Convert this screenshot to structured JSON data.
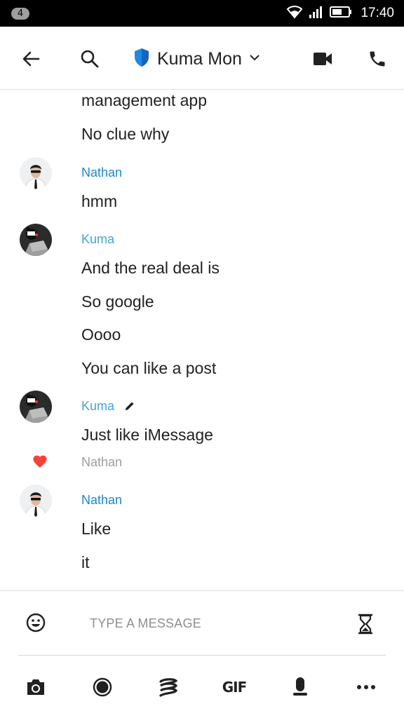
{
  "status_bar": {
    "notification_count": "4",
    "time": "17:40",
    "icons": [
      "wifi-icon",
      "signal-icon",
      "battery-icon"
    ]
  },
  "header": {
    "title": "Kuma Mon",
    "icons": [
      "back-arrow-icon",
      "search-icon",
      "shield-icon",
      "chevron-down-icon",
      "video-call-icon",
      "phone-icon"
    ]
  },
  "colors": {
    "accent": "#1e88c7",
    "shield": "#1e88e5",
    "heart": "#f44336"
  },
  "messages": {
    "continuation": [
      "management app",
      "No clue why"
    ],
    "group1": {
      "sender": "Nathan",
      "lines": [
        "hmm"
      ]
    },
    "group2": {
      "sender": "Kuma",
      "lines": [
        "And the real deal is",
        "So google",
        "Oooo",
        "You can like a post"
      ]
    },
    "group3": {
      "sender": "Kuma",
      "lines": [
        "Just like iMessage"
      ],
      "reaction_by": "Nathan"
    },
    "group4": {
      "sender": "Nathan",
      "lines": [
        "Like",
        "it"
      ]
    }
  },
  "composer": {
    "placeholder": "TYPE A MESSAGE"
  },
  "toolbar": {
    "gif_label": "GIF",
    "icons": [
      "camera-icon",
      "record-icon",
      "sticker-icon",
      "gif-button",
      "microphone-icon",
      "more-icon"
    ]
  }
}
